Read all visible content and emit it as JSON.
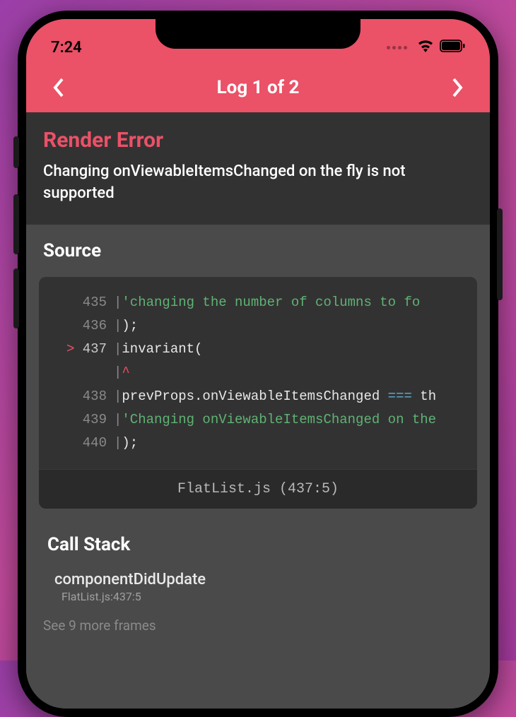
{
  "status": {
    "time": "7:24"
  },
  "nav": {
    "title": "Log 1 of 2"
  },
  "error": {
    "title": "Render Error",
    "message": "Changing onViewableItemsChanged on the fly is not supported"
  },
  "source": {
    "title": "Source",
    "footer": "FlatList.js (437:5)",
    "lines": [
      {
        "num": "435",
        "active": false,
        "segments": [
          {
            "t": "    ",
            "c": "plain"
          },
          {
            "t": "'changing the number of columns to fo",
            "c": "str"
          }
        ]
      },
      {
        "num": "436",
        "active": false,
        "segments": [
          {
            "t": ");",
            "c": "plain"
          }
        ]
      },
      {
        "num": "437",
        "active": true,
        "segments": [
          {
            "t": "invariant(",
            "c": "plain"
          }
        ]
      },
      {
        "num": "",
        "active": false,
        "segments": [
          {
            "t": "^",
            "c": "caret"
          }
        ]
      },
      {
        "num": "438",
        "active": false,
        "segments": [
          {
            "t": "  prevProps.onViewableItemsChanged ",
            "c": "plain"
          },
          {
            "t": "===",
            "c": "op"
          },
          {
            "t": " th",
            "c": "plain"
          }
        ]
      },
      {
        "num": "439",
        "active": false,
        "segments": [
          {
            "t": "  ",
            "c": "plain"
          },
          {
            "t": "'Changing onViewableItemsChanged on the",
            "c": "str"
          }
        ]
      },
      {
        "num": "440",
        "active": false,
        "segments": [
          {
            "t": ");",
            "c": "plain"
          }
        ]
      }
    ]
  },
  "callstack": {
    "title": "Call Stack",
    "frame": {
      "name": "componentDidUpdate",
      "loc": "FlatList.js:437:5"
    },
    "more": "See 9 more frames"
  }
}
